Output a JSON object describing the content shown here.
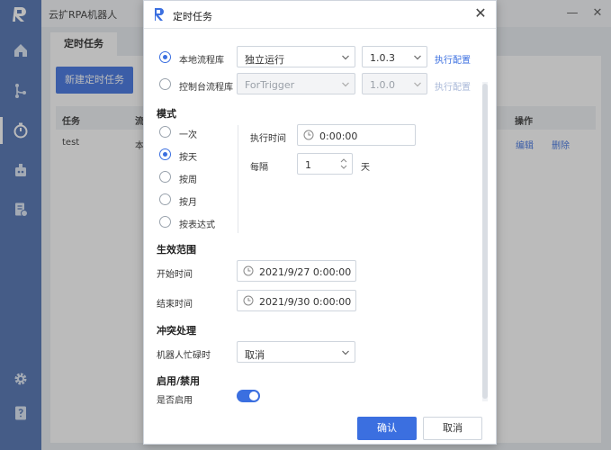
{
  "app": {
    "title": "云扩RPA机器人",
    "tab_label": "定时任务",
    "new_task_label": "新建定时任务",
    "columns": [
      "任务",
      "流",
      "操作"
    ],
    "rows": [
      {
        "name": "test",
        "flow_partial": "本",
        "edit": "编辑",
        "delete": "删除"
      }
    ]
  },
  "dialog": {
    "title": "定时任务",
    "source_options": [
      {
        "label": "本地流程库",
        "selected": true,
        "process": "独立运行",
        "version": "1.0.3",
        "config_link": "执行配置",
        "disabled": false
      },
      {
        "label": "控制台流程库",
        "selected": false,
        "process": "ForTrigger",
        "version": "1.0.0",
        "config_link": "执行配置",
        "disabled": true
      }
    ],
    "mode": {
      "section_title": "模式",
      "options": [
        "一次",
        "按天",
        "按周",
        "按月",
        "按表达式"
      ],
      "selected_index": 1,
      "exec_time_label": "执行时间",
      "exec_time_value": "0:00:00",
      "interval_label": "每隔",
      "interval_value": "1",
      "interval_unit": "天"
    },
    "range": {
      "section_title": "生效范围",
      "start_label": "开始时间",
      "start_value": "2021/9/27 0:00:00",
      "end_label": "结束时间",
      "end_value": "2021/9/30 0:00:00"
    },
    "conflict": {
      "section_title": "冲突处理",
      "busy_label": "机器人忙碌时",
      "busy_value": "取消"
    },
    "enable": {
      "section_title": "启用/禁用",
      "enabled_label": "是否启用",
      "enabled": true
    },
    "confirm_label": "确认",
    "cancel_label": "取消"
  },
  "colors": {
    "accent": "#3b6fe0",
    "sidebar": "#4a6eb0"
  }
}
